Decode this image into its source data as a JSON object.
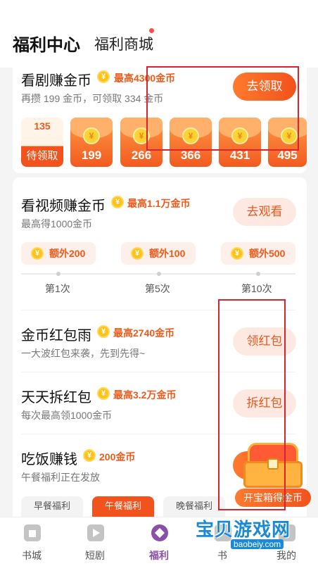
{
  "header": {
    "title": "福利中心",
    "tab2": "福利商城"
  },
  "drama": {
    "title": "看剧赚金币",
    "reward": "最高4300金币",
    "subtitle": "再攒 199 金币，可领取 334 金币",
    "button": "去领取",
    "envelopes": [
      {
        "top": "135",
        "label": "待领取"
      },
      {
        "label": "199"
      },
      {
        "label": "266"
      },
      {
        "label": "366"
      },
      {
        "label": "431"
      },
      {
        "label": "495"
      }
    ]
  },
  "video": {
    "title": "看视频赚金币",
    "reward": "最高1.1万金币",
    "subtitle": "最高得1000金币",
    "button": "去观看",
    "bonuses": [
      "额外200",
      "额外100",
      "额外500"
    ],
    "steps": [
      "第1次",
      "第5次",
      "第10次"
    ]
  },
  "rain": {
    "title": "金币红包雨",
    "reward": "最高2740金币",
    "subtitle": "一大波红包来袭，先到先得~",
    "button": "领红包"
  },
  "daily": {
    "title": "天天拆红包",
    "reward": "最高3.2万金币",
    "subtitle": "每次最高领1000金币",
    "button": "拆红包"
  },
  "meal": {
    "title": "吃饭赚钱",
    "reward": "200金币",
    "subtitle": "午餐福利正在发放",
    "tabs": [
      "早餐福利",
      "午餐福利",
      "晚餐福利"
    ]
  },
  "chest": {
    "label": "开宝箱得金币"
  },
  "coin_glyph": "¥",
  "tabbar": [
    "书城",
    "短剧",
    "福利",
    "书",
    "我的"
  ],
  "watermark": {
    "big": "宝贝游戏网",
    "small": "baobeiy.com"
  },
  "colors": {
    "accent": "#f2521c",
    "reward": "#ef5a1b",
    "coin": "#ffc21a",
    "active_tab": "#8a4fa8"
  }
}
